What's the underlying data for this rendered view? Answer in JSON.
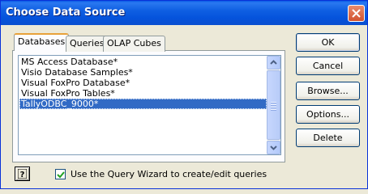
{
  "window": {
    "title": "Choose Data Source"
  },
  "tabs": [
    {
      "label": "Databases",
      "active": true
    },
    {
      "label": "Queries",
      "active": false
    },
    {
      "label": "OLAP Cubes",
      "active": false
    }
  ],
  "list": {
    "items": [
      "MS Access Database*",
      "Visio Database Samples*",
      "Visual FoxPro Database*",
      "Visual FoxPro Tables*",
      "TallyODBC_9000*"
    ],
    "selected_index": 4
  },
  "buttons": {
    "ok": "OK",
    "cancel": "Cancel",
    "browse": "Browse...",
    "options": "Options...",
    "delete": "Delete"
  },
  "query_wizard": {
    "label": "Use the Query Wizard to create/edit queries",
    "checked": true
  },
  "colors": {
    "titlebar": "#0553dc",
    "selection": "#316ac5",
    "face": "#ece9d8"
  }
}
